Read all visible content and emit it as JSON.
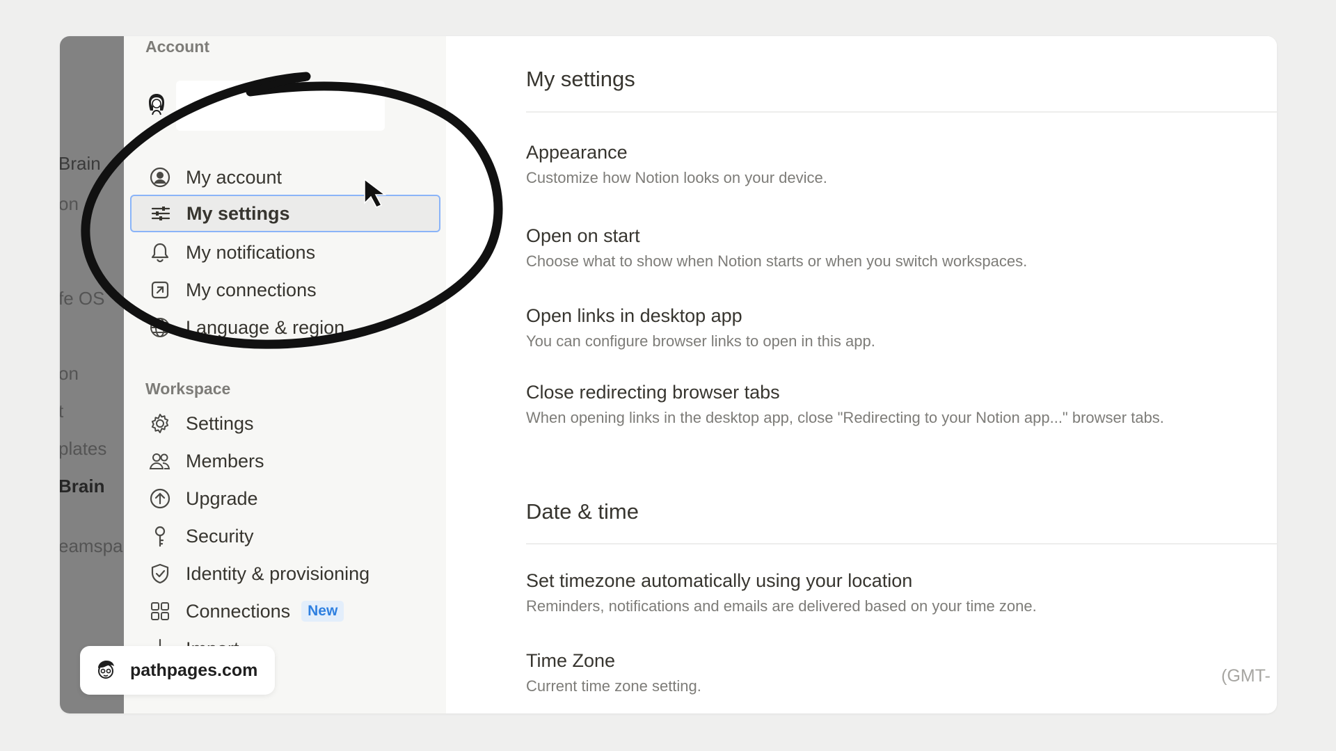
{
  "background_sidebar": {
    "fragments": [
      "Brain",
      "on",
      "fe OS",
      "on",
      "t",
      "plates",
      "Brain",
      "eamspa"
    ]
  },
  "nav": {
    "account_section": "Account",
    "account_items": [
      {
        "label": "My account",
        "icon": "user-circle-icon"
      },
      {
        "label": "My settings",
        "icon": "sliders-icon",
        "active": true
      },
      {
        "label": "My notifications",
        "icon": "bell-icon"
      },
      {
        "label": "My connections",
        "icon": "external-link-icon"
      },
      {
        "label": "Language & region",
        "icon": "globe-icon"
      }
    ],
    "workspace_section": "Workspace",
    "workspace_items": [
      {
        "label": "Settings",
        "icon": "gear-icon"
      },
      {
        "label": "Members",
        "icon": "people-icon"
      },
      {
        "label": "Upgrade",
        "icon": "arrow-up-circle-icon"
      },
      {
        "label": "Security",
        "icon": "key-icon"
      },
      {
        "label": "Identity & provisioning",
        "icon": "shield-check-icon"
      },
      {
        "label": "Connections",
        "icon": "grid-icon",
        "badge": "New"
      },
      {
        "label": "Import",
        "icon": "download-arrow-icon"
      }
    ]
  },
  "main": {
    "title": "My settings",
    "options": [
      {
        "title": "Appearance",
        "desc": "Customize how Notion looks on your device."
      },
      {
        "title": "Open on start",
        "desc": "Choose what to show when Notion starts or when you switch workspaces."
      },
      {
        "title": "Open links in desktop app",
        "desc": "You can configure browser links to open in this app."
      },
      {
        "title": "Close redirecting browser tabs",
        "desc": "When opening links in the desktop app, close \"Redirecting to your Notion app...\" browser tabs."
      }
    ],
    "date_time_title": "Date & time",
    "date_options": [
      {
        "title": "Set timezone automatically using your location",
        "desc": "Reminders, notifications and emails are delivered based on your time zone."
      },
      {
        "title": "Time Zone",
        "desc": "Current time zone setting.",
        "value": "(GMT-"
      }
    ]
  },
  "watermark": {
    "text": "pathpages.com"
  },
  "colors": {
    "accent_outline": "#8ab4f8",
    "badge_text": "#2f80e0",
    "badge_bg": "#e3eefb"
  }
}
